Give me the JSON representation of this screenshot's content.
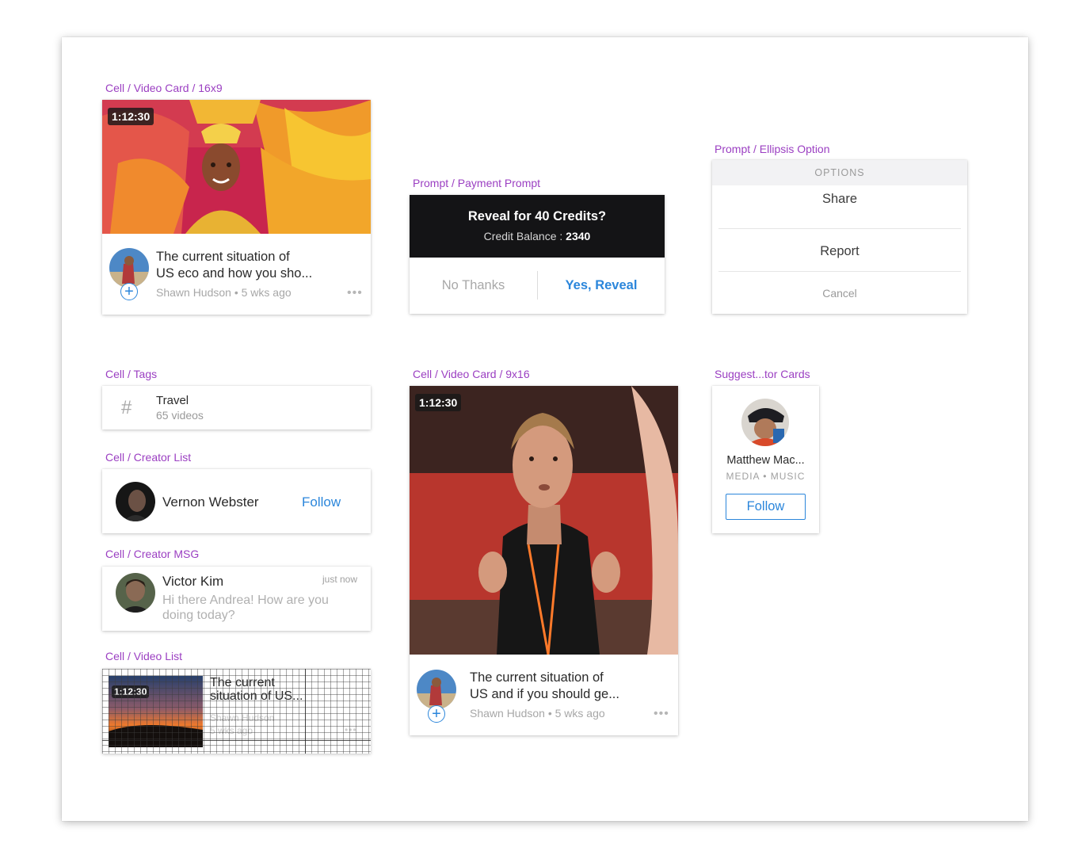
{
  "labels": {
    "video_card_16x9": "Cell / Video Card / 16x9",
    "payment_prompt": "Prompt / Payment Prompt",
    "ellipsis_option": "Prompt / Ellipsis Option",
    "tags": "Cell / Tags",
    "video_card_9x16": "Cell / Video Card / 9x16",
    "suggest_cards": "Suggest...tor Cards",
    "creator_list": "Cell / Creator List",
    "creator_msg": "Cell / Creator MSG",
    "video_list": "Cell / Video List"
  },
  "video_card_16x9": {
    "duration": "1:12:30",
    "title_line1": "The current situation of",
    "title_line2": "US eco and how you sho...",
    "meta": "Shawn Hudson • 5 wks ago",
    "plus": "+",
    "more": "•••"
  },
  "payment_prompt": {
    "title": "Reveal for 40 Credits?",
    "balance_label": "Credit Balance : ",
    "balance_value": "2340",
    "decline": "No Thanks",
    "confirm": "Yes, Reveal"
  },
  "ellipsis_option": {
    "header": "OPTIONS",
    "items": [
      "Share",
      "Report"
    ],
    "cancel": "Cancel"
  },
  "tags": {
    "symbol": "#",
    "name": "Travel",
    "count": "65 videos"
  },
  "video_card_9x16": {
    "duration": "1:12:30",
    "title_line1": "The current situation of",
    "title_line2": "US and if you should ge...",
    "meta": "Shawn Hudson • 5 wks ago",
    "plus": "+",
    "more": "•••"
  },
  "suggested_creator": {
    "name": "Matthew Mac...",
    "category": "MEDIA • MUSIC",
    "follow": "Follow"
  },
  "creator_list": {
    "name": "Vernon Webster",
    "follow": "Follow"
  },
  "creator_msg": {
    "name": "Victor Kim",
    "time": "just now",
    "message_line1": "Hi there Andrea! How are you",
    "message_line2": "doing today?"
  },
  "video_list": {
    "duration": "1:12:30",
    "title_line1": "The current",
    "title_line2": "situation of US...",
    "meta_line1": "Shawn Hudson",
    "meta_line2": "5 wks ago",
    "more": "•••"
  },
  "colors": {
    "label_purple": "#9b3fc2",
    "accent_blue": "#2b86db",
    "prompt_dark": "#141416"
  }
}
